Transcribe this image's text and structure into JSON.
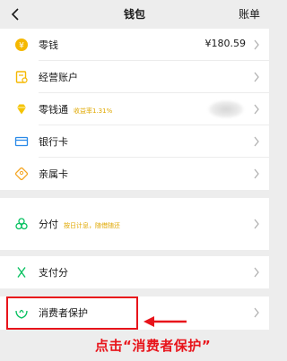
{
  "header": {
    "title": "钱包",
    "right_label": "账单",
    "back_icon": "back-arrow-icon"
  },
  "rows": {
    "lingqian": {
      "label": "零钱",
      "value": "¥180.59",
      "icon": "yuan-coin-icon"
    },
    "jingying": {
      "label": "经营账户",
      "icon": "business-account-icon"
    },
    "lingqiantong": {
      "label": "零钱通",
      "tag": "收益率1.31%",
      "icon": "diamond-icon"
    },
    "yinhangka": {
      "label": "银行卡",
      "icon": "bank-card-icon"
    },
    "qinshuka": {
      "label": "亲属卡",
      "icon": "family-card-icon"
    },
    "fenfu": {
      "label": "分付",
      "tag": "按日计息，随借随还",
      "icon": "fenfu-icon"
    },
    "zhifufen": {
      "label": "支付分",
      "icon": "pay-score-icon"
    },
    "xiaofeizhe": {
      "label": "消费者保护",
      "icon": "consumer-protection-icon"
    }
  },
  "annotation": {
    "text": "点击“消费者保护”"
  },
  "colors": {
    "brand_green": "#07c160",
    "highlight_red": "#e8141b",
    "tag_gold": "#e0a800"
  }
}
